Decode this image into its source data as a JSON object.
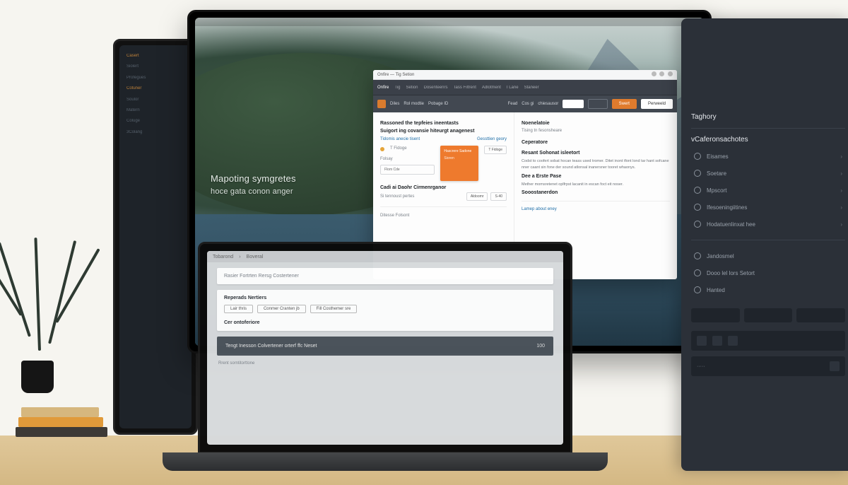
{
  "hero": {
    "line1": "Mapoting symgretes",
    "line2": "hoce gata conon anger"
  },
  "back_laptop": {
    "items": [
      "Casert",
      "Siolert",
      "Profegues",
      "Cotuner",
      "Soulor",
      "Matern",
      "Coluge",
      "3Colang"
    ]
  },
  "app": {
    "title": "Onfire — Tig Setion",
    "tabs": [
      "Onfire",
      "Tig",
      "Setion",
      "Dosenteenrs",
      "Tass Filtrent",
      "Adlotment",
      "I Lane",
      "Staneer"
    ],
    "toolbar": {
      "mode_a": "Diles",
      "mode_b": "Rol modtie",
      "mode_c": "Pobage ID",
      "seg_a": "Fead",
      "seg_b": "Cos gi",
      "seg_c": "chiesausor",
      "btn_primary": "Swert",
      "btn_secondary": "Perweeld"
    },
    "left": {
      "h1": "Rassoned the tepfeies ineentasts",
      "h2": "Suigort ing covansie hiteurgt anagenest",
      "link1": "Tidomis anecie tisent",
      "link2": "Gessttien geory",
      "card_title": "Hascrere Sadone",
      "card_sub": "Sioren",
      "chip": "T Fidoge",
      "field_label1": "Folsay",
      "field_ph1": "Flom Cde",
      "section2": "Cadi ai Daohr Cirmenrganor",
      "sub2": "Si tennoust pertes",
      "chip2": "Aldoomr",
      "chip3": "S-40",
      "footer": "Ditesse Folsont"
    },
    "right": {
      "h1": "Noenelatoie",
      "sub": "Tising tn fesonsheare",
      "h2": "Ceperatore",
      "h3": "Resant Sohonat isleetort",
      "para": "Codst to coofert sobat hocan teass used tromer. Ditet inont tfont lond tar hant sofcane nner caant sin fone der sound atlonsal inanersner tooret whaonys.",
      "h4": "Dee a Erste Pase",
      "para2": "Mether momsretenet oplfrpst lacanit in escan foct eit noser.",
      "h5": "Sooostanerdon",
      "link": "Lamep about eney"
    }
  },
  "front_laptop": {
    "bar": [
      "Tobarond",
      "Boveral"
    ],
    "title": "Rasier Fortrten Rersg Costertener",
    "h1": "Reperads Nertiers",
    "pills": [
      "Lair thris",
      "Conmer Cranten jb",
      "Fill Costhemer sre"
    ],
    "h2": "Cer ontoferiore",
    "dark": "Tengt Inesson Colvertener orterf ffc Neset",
    "dark_num": "100",
    "foot": "Rrent sorntitorttone"
  },
  "sidepanel": {
    "section1": "Taghory",
    "section2": "vCaferonsachotes",
    "items1": [
      "Eisames",
      "Soetare",
      "Mpscort",
      "Ifesoeningiitines",
      "Hodatuenlinxat hee"
    ],
    "items2": [
      "Jandosmel",
      "Dooo lel lors Setort",
      "Hanted"
    ]
  }
}
